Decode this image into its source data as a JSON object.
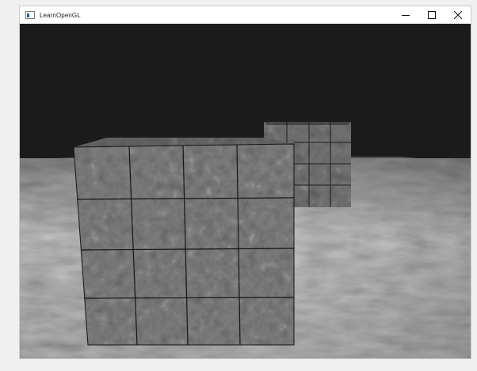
{
  "window": {
    "title": "LearnOpenGL",
    "controls": {
      "minimize": "minimize-icon",
      "maximize": "maximize-icon",
      "close": "close-icon"
    }
  },
  "scene": {
    "clear_color": "#1b1b1b",
    "floor_color": "#555758",
    "cube_color": "#3a3a3a",
    "grid_line_color": "#1a1a1a"
  }
}
